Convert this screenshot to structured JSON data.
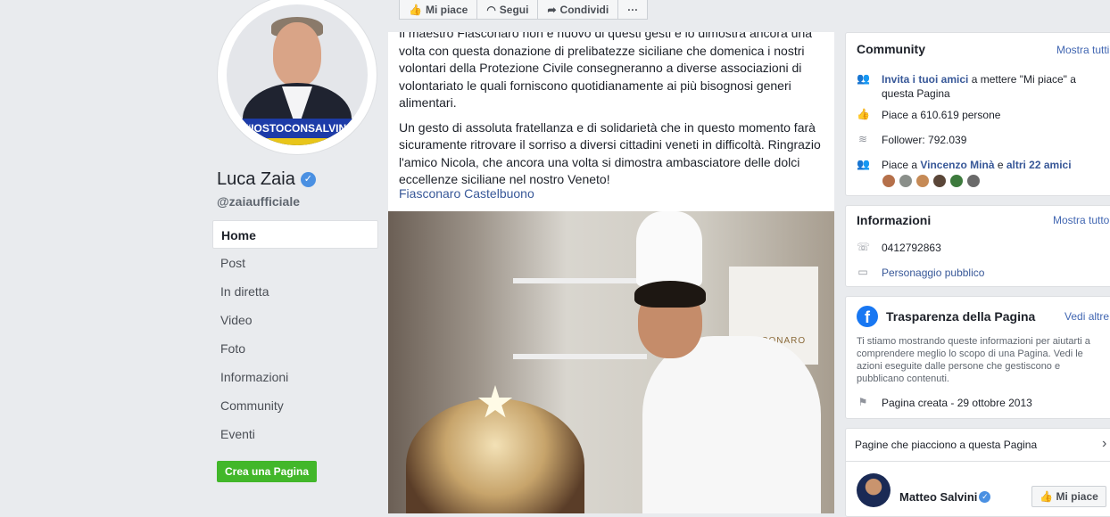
{
  "profile": {
    "banner_text": "#IOSTOCONSALVINI",
    "name": "Luca Zaia",
    "verified_icon": "verified-badge-icon",
    "handle": "@zaiaufficiale"
  },
  "nav": {
    "items": [
      {
        "label": "Home",
        "active": true
      },
      {
        "label": "Post"
      },
      {
        "label": "In diretta"
      },
      {
        "label": "Video"
      },
      {
        "label": "Foto"
      },
      {
        "label": "Informazioni"
      },
      {
        "label": "Community"
      },
      {
        "label": "Eventi"
      }
    ],
    "create_page": "Crea una Pagina"
  },
  "actions": {
    "like": "Mi piace",
    "follow": "Segui",
    "share": "Condividi",
    "more": "···"
  },
  "post": {
    "para1": "Il maestro Fiasconaro non è nuovo di questi gesti e lo dimostra ancora una volta con questa donazione di prelibatezze siciliane che domenica i nostri volontari della Protezione Civile consegneranno a diverse associazioni di volontariato le quali forniscono quotidianamente ai più bisognosi generi alimentari.",
    "para2": "Un gesto di assoluta fratellanza e di solidarietà che in questo momento farà sicuramente ritrovare il sorriso a diversi cittadini veneti in difficoltà. Ringrazio l'amico Nicola, che ancora una volta si dimostra ambasciatore delle dolci eccellenze siciliane nel nostro Veneto!",
    "tag_link": "Fiasconaro Castelbuono",
    "photo_sign": "FIASCONARO"
  },
  "community": {
    "title": "Community",
    "see_all": "Mostra tutti",
    "invite_link": "Invita i tuoi amici",
    "invite_rest": " a mettere \"Mi piace\" a questa Pagina",
    "likes": "Piace a 610.619 persone",
    "followers": "Follower: 792.039",
    "liked_by_prefix": "Piace a ",
    "liked_by_name": "Vincenzo Minà",
    "liked_by_mid": " e ",
    "liked_by_others": "altri 22 amici"
  },
  "info": {
    "title": "Informazioni",
    "see_all": "Mostra tutto",
    "phone": "0412792863",
    "category": "Personaggio pubblico"
  },
  "transparency": {
    "title": "Trasparenza della Pagina",
    "see_more": "Vedi altre",
    "description": "Ti stiamo mostrando queste informazioni per aiutarti a comprendere meglio lo scopo di una Pagina. Vedi le azioni eseguite dalle persone che gestiscono e pubblicano contenuti.",
    "created": "Pagina creata - 29 ottobre 2013"
  },
  "liked_pages": {
    "title": "Pagine che piacciono a questa Pagina",
    "page_name": "Matteo Salvini",
    "like_button": "Mi piace"
  }
}
